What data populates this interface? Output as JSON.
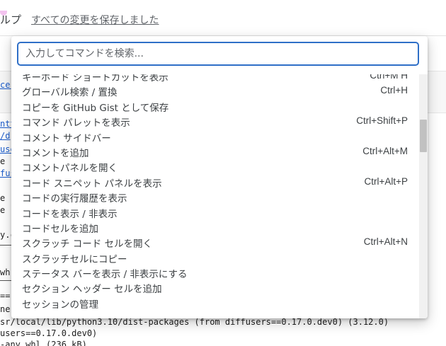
{
  "menubar": {
    "help_fragment": "ルプ",
    "save_status": "すべての変更を保存しました"
  },
  "background": {
    "fragments": [
      "ce,",
      "ntt",
      "/d",
      "use",
      "e -",
      "fus",
      "e",
      "e",
      "y.c",
      "wh",
      "==(",
      "ne-"
    ],
    "output_lines": [
      "sr/local/lib/python3.10/dist-packages (from diffusers==0.17.0.dev0) (3.12.0)",
      "users==0.17.0.dev0)",
      "-any.whl (236 kB)"
    ]
  },
  "palette": {
    "search_placeholder": "入力してコマンドを検索...",
    "commands": [
      {
        "label": "キーボード ショートカットを表示",
        "shortcut": "Ctrl+M H"
      },
      {
        "label": "グローバル検索 / 置換",
        "shortcut": "Ctrl+H"
      },
      {
        "label": "コピーを GitHub Gist として保存",
        "shortcut": ""
      },
      {
        "label": "コマンド パレットを表示",
        "shortcut": "Ctrl+Shift+P"
      },
      {
        "label": "コメント サイドバー",
        "shortcut": ""
      },
      {
        "label": "コメントを追加",
        "shortcut": "Ctrl+Alt+M"
      },
      {
        "label": "コメントパネルを開く",
        "shortcut": ""
      },
      {
        "label": "コード スニペット パネルを表示",
        "shortcut": "Ctrl+Alt+P"
      },
      {
        "label": "コードの実行履歴を表示",
        "shortcut": ""
      },
      {
        "label": "コードを表示 / 非表示",
        "shortcut": ""
      },
      {
        "label": "コードセルを追加",
        "shortcut": ""
      },
      {
        "label": "スクラッチ コード セルを開く",
        "shortcut": "Ctrl+Alt+N"
      },
      {
        "label": "スクラッチセルにコピー",
        "shortcut": ""
      },
      {
        "label": "ステータス バーを表示 / 非表示にする",
        "shortcut": ""
      },
      {
        "label": "セクション ヘッダー セルを追加",
        "shortcut": ""
      },
      {
        "label": "セッションの管理",
        "shortcut": ""
      }
    ]
  },
  "colors": {
    "accent": "#2f6fc7",
    "text": "#3c4043"
  }
}
